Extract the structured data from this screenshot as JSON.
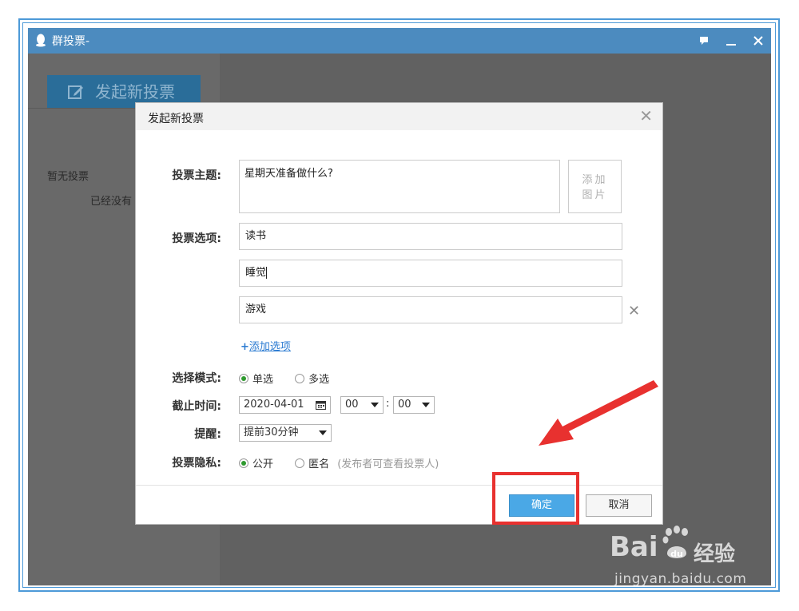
{
  "window": {
    "title": "群投票-",
    "controls": [
      "feedback-icon",
      "minimize-icon",
      "close-icon"
    ]
  },
  "left_pane": {
    "new_vote_button": "发起新投票",
    "empty_label": "暂无投票",
    "empty_sub": "已经没有"
  },
  "dialog": {
    "title": "发起新投票",
    "topic_label": "投票主题:",
    "topic_value": "星期天准备做什么?",
    "add_image": "添加图片",
    "options_label": "投票选项:",
    "options": [
      "读书",
      "睡觉",
      "游戏"
    ],
    "add_option": "添加选项",
    "mode_label": "选择模式:",
    "mode_single": "单选",
    "mode_multi": "多选",
    "mode_selected": "单选",
    "deadline_label": "截止时间:",
    "deadline_date": "2020-04-01",
    "deadline_hour": "00",
    "deadline_minute": "00",
    "deadline_sep": ":",
    "remind_label": "提醒:",
    "remind_value": "提前30分钟",
    "privacy_label": "投票隐私:",
    "privacy_public": "公开",
    "privacy_anon": "匿名",
    "privacy_anon_note": "(发布者可查看投票人)",
    "privacy_selected": "公开",
    "ok_button": "确定",
    "cancel_button": "取消"
  },
  "annotation": {
    "color": "#e8312f"
  },
  "watermark": {
    "brand": "Bai",
    "brand_suffix": "经验",
    "url": "jingyan.baidu.com"
  }
}
